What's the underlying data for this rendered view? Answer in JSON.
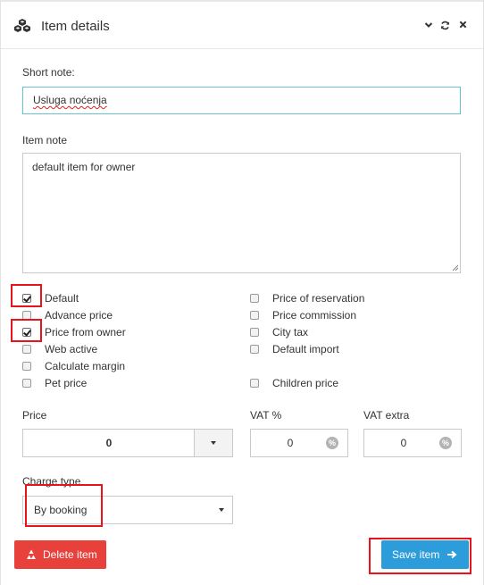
{
  "header": {
    "title": "Item details",
    "logo_icon": "cubes-icon",
    "tools": [
      "chevron-down-icon",
      "refresh-icon",
      "close-icon"
    ]
  },
  "form": {
    "short_note": {
      "label": "Short note:",
      "value": "Usluga noćenja"
    },
    "item_note": {
      "label": "Item note",
      "value": "default item for owner"
    },
    "checkboxes_left": [
      {
        "label": "Default",
        "checked": true
      },
      {
        "label": "Advance price",
        "checked": false
      },
      {
        "label": "Price from owner",
        "checked": true
      },
      {
        "label": "Web active",
        "checked": false
      },
      {
        "label": "Calculate margin",
        "checked": false
      },
      {
        "label": "Pet price",
        "checked": false
      }
    ],
    "checkboxes_right": [
      {
        "label": "Price of reservation",
        "checked": false
      },
      {
        "label": "Price commission",
        "checked": false
      },
      {
        "label": "City tax",
        "checked": false
      },
      {
        "label": "Default import",
        "checked": false
      },
      {
        "label": "Children price",
        "checked": false
      }
    ],
    "price": {
      "label": "Price",
      "value": "0"
    },
    "vat": {
      "label": "VAT %",
      "value": "0",
      "suffix": "%"
    },
    "vat_extra": {
      "label": "VAT extra",
      "value": "0",
      "suffix": "%"
    },
    "charge_type": {
      "label": "Charge type",
      "value": "By booking"
    }
  },
  "actions": {
    "delete_label": "Delete item",
    "save_label": "Save item"
  },
  "colors": {
    "delete": "#e8413c",
    "save": "#2d9cdb",
    "highlight": "#e8141b",
    "focus_border": "#64c3cf"
  }
}
